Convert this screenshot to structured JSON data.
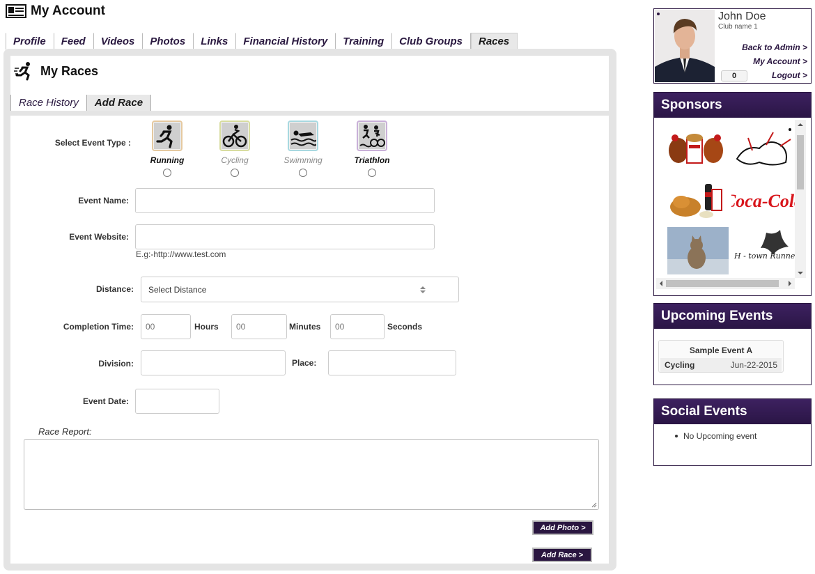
{
  "page_title": "My Account",
  "main_tabs": [
    {
      "label": "Profile"
    },
    {
      "label": "Feed"
    },
    {
      "label": "Videos"
    },
    {
      "label": "Photos"
    },
    {
      "label": "Links"
    },
    {
      "label": "Financial History"
    },
    {
      "label": "Training"
    },
    {
      "label": "Club Groups"
    },
    {
      "label": "Races"
    }
  ],
  "active_tab": "Races",
  "races": {
    "title": "My Races",
    "sub_tabs": [
      {
        "label": "Race History"
      },
      {
        "label": "Add Race"
      }
    ],
    "active_sub_tab": "Add Race"
  },
  "form": {
    "event_type_label": "Select Event Type :",
    "event_types": [
      {
        "label": "Running",
        "icon": "running-icon"
      },
      {
        "label": "Cycling",
        "icon": "cycling-icon"
      },
      {
        "label": "Swimming",
        "icon": "swimming-icon"
      },
      {
        "label": "Triathlon",
        "icon": "triathlon-icon"
      }
    ],
    "event_name_label": "Event Name:",
    "event_name_value": "",
    "event_website_label": "Event Website:",
    "event_website_value": "",
    "event_website_hint": "E.g:-http://www.test.com",
    "distance_label": "Distance:",
    "distance_selected": "Select Distance",
    "completion_time_label": "Completion Time:",
    "hours_placeholder": "00",
    "hours_label": "Hours",
    "minutes_placeholder": "00",
    "minutes_label": "Minutes",
    "seconds_placeholder": "00",
    "seconds_label": "Seconds",
    "division_label": "Division:",
    "place_label": "Place:",
    "event_date_label": "Event Date:",
    "race_report_label": "Race Report",
    "race_report_colon": ":",
    "add_photo_label": "Add Photo >",
    "add_race_label": "Add Race >"
  },
  "user": {
    "name": "John Doe",
    "club": "Club name 1",
    "links": [
      "Back to Admin >",
      "My Account >",
      "Logout >"
    ],
    "counter": "0"
  },
  "sponsors": {
    "title": "Sponsors",
    "items": [
      {
        "alt": "kfc-chicken",
        "text": ""
      },
      {
        "alt": "cartoon-sketch",
        "text": ""
      },
      {
        "alt": "fried-chicken",
        "text": ""
      },
      {
        "alt": "coca-cola",
        "text": "Coca-Cola"
      },
      {
        "alt": "cat-photo",
        "text": ""
      },
      {
        "alt": "htown-runners",
        "text": "H - town Runners"
      }
    ]
  },
  "upcoming_events": {
    "title": "Upcoming Events",
    "event_name": "Sample Event A",
    "event_type": "Cycling",
    "event_date": "Jun-22-2015"
  },
  "social_events": {
    "title": "Social Events",
    "items": [
      "No Upcoming event"
    ]
  },
  "colors": {
    "brand": "#2a1640",
    "panel_bg": "#e4e4e4"
  }
}
